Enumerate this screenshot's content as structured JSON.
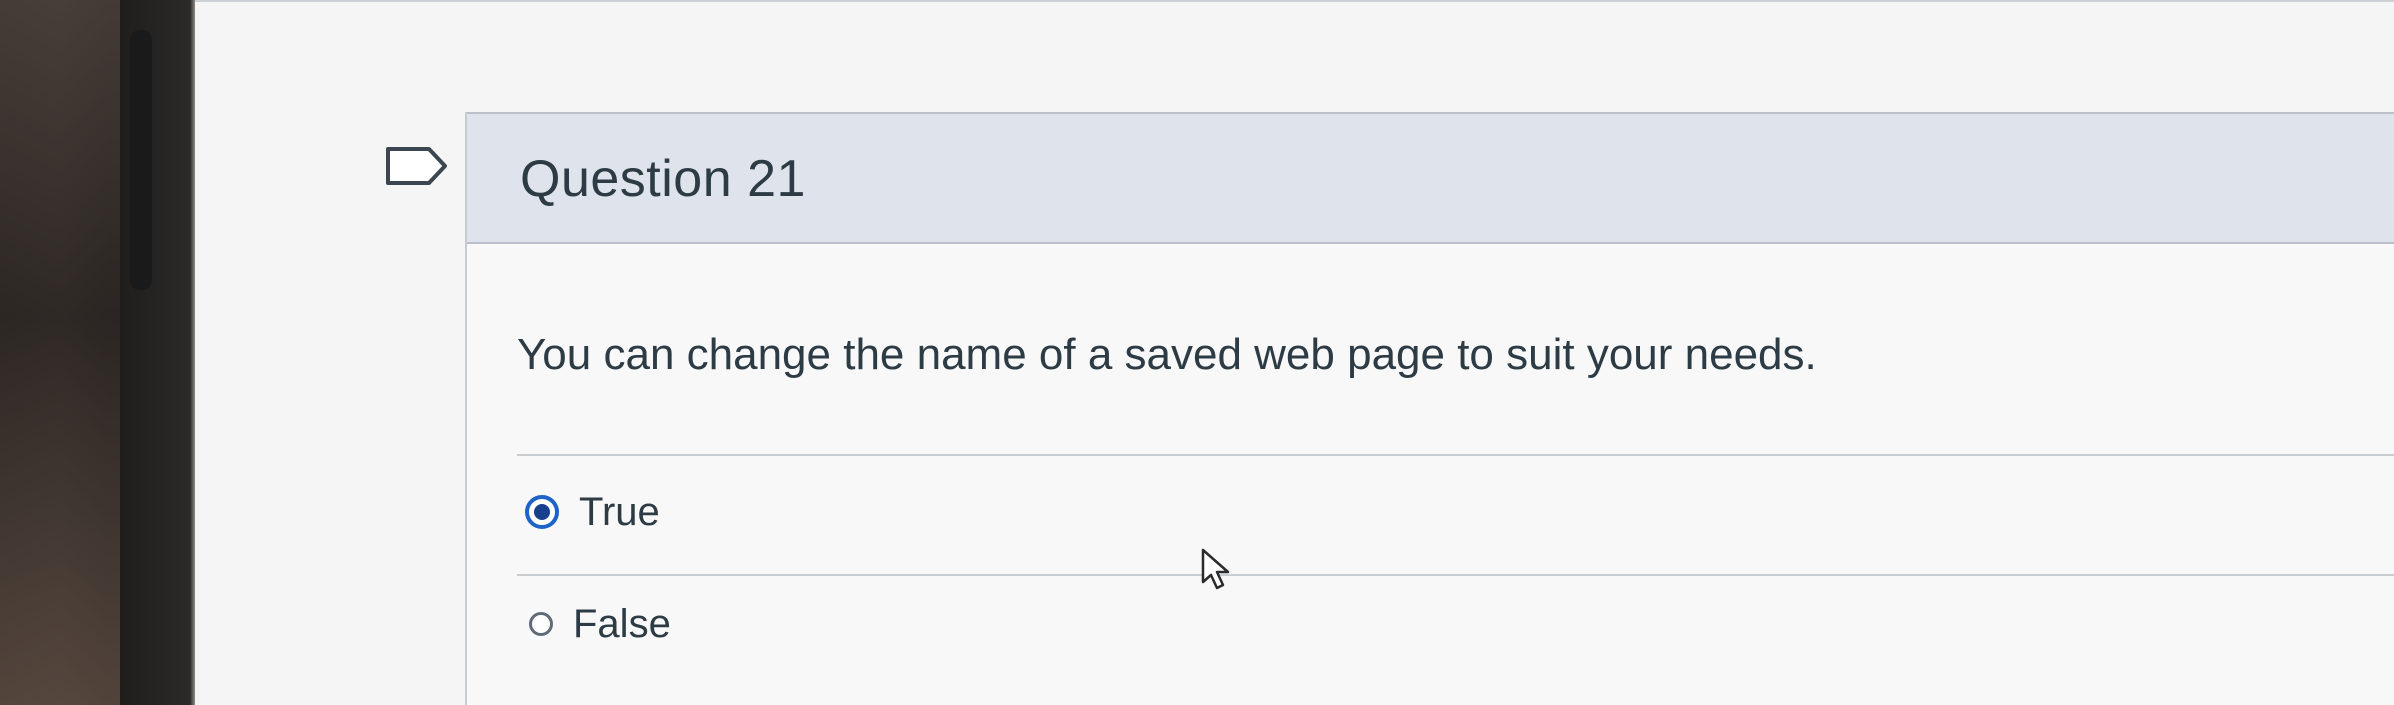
{
  "question": {
    "title": "Question 21",
    "text": "You can change the name of a saved web page to suit your needs.",
    "answers": [
      {
        "label": "True",
        "selected": true
      },
      {
        "label": "False",
        "selected": false
      }
    ]
  },
  "colors": {
    "header_bg": "#dfe4ec",
    "text": "#2d3b45",
    "radio_selected": "#1e64c8"
  },
  "icons": {
    "flag": "flag-icon",
    "cursor": "mouse-pointer-icon"
  }
}
